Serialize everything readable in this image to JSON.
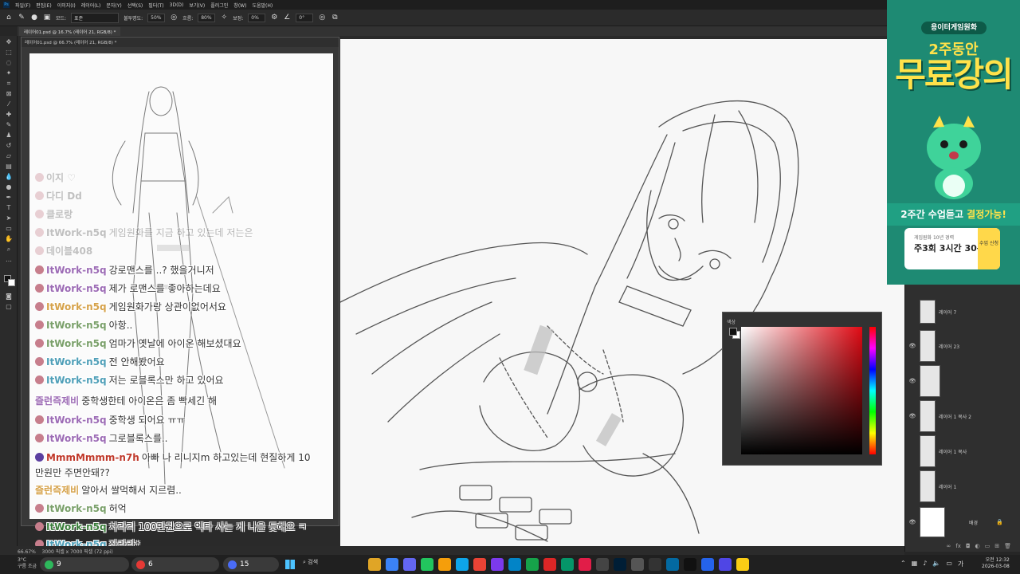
{
  "menubar": {
    "items": [
      "파일(F)",
      "편집(E)",
      "이미지(I)",
      "레이어(L)",
      "문자(Y)",
      "선택(S)",
      "필터(T)",
      "3D(D)",
      "보기(V)",
      "플러그인",
      "창(W)",
      "도움말(H)"
    ]
  },
  "options": {
    "mode_label": "모드:",
    "mode_value": "표준",
    "opacity_label": "불투명도:",
    "opacity_value": "50%",
    "flow_label": "흐름:",
    "flow_value": "80%",
    "smoothing_label": "보정:",
    "smoothing_value": "0%",
    "angle_value": "0°"
  },
  "document": {
    "tab_label": "레이어01.psd @ 16.7% (레이어 21, RGB/8) *",
    "float_title": "레이어01.psd @ 66.7% (레이어 21, RGB/8) *",
    "status_zoom": "66.67%",
    "status_size": "3000 픽셀 x 7000 픽셀 (72 ppi)"
  },
  "chat": {
    "messages": [
      {
        "name": "이지 ♡",
        "text": "",
        "faded": true,
        "color": "#aaaaaa"
      },
      {
        "name": "다디 Dd",
        "text": "",
        "faded": true,
        "color": "#aaaaaa"
      },
      {
        "name": "클로랑",
        "text": "",
        "faded": true,
        "color": "#aaaaaa"
      },
      {
        "name": "ItWork-n5q",
        "text": "게임원화를 지금 하고 있는데 저는은",
        "faded": true,
        "color": "#8a8a8a"
      },
      {
        "name": "데이블408",
        "text": "",
        "faded": true,
        "color": "#c77e8c"
      },
      {
        "name": "ItWork-n5q",
        "text": "강로맨스를 ..? 했을거니저",
        "faded": false,
        "color": "#9c6bb5"
      },
      {
        "name": "ItWork-n5q",
        "text": "제가 로맨스를 좋아하는데요",
        "faded": false,
        "color": "#9c6bb5"
      },
      {
        "name": "ItWork-n5q",
        "text": "게임원화가랑 상관이없어서요",
        "faded": false,
        "color": "#d6a24a"
      },
      {
        "name": "ItWork-n5q",
        "text": "아항..",
        "faded": false,
        "color": "#7aa06a"
      },
      {
        "name": "ItWork-n5q",
        "text": "엄마가 옛날에 아이온 해보셨대요",
        "faded": false,
        "color": "#7aa06a"
      },
      {
        "name": "ItWork-n5q",
        "text": "전 안해봤어요",
        "faded": false,
        "color": "#4f9fb8"
      },
      {
        "name": "ItWork-n5q",
        "text": "저는 로블록스만 하고 있어요",
        "faded": false,
        "color": "#4f9fb8"
      },
      {
        "name": "즐런즉제비",
        "text": "중학생한테 아이온은 좀 빡세긴 해",
        "faded": false,
        "color": "#9c6bb5"
      },
      {
        "name": "ItWork-n5q",
        "text": "중학생 되어요 ㅠㅠ",
        "faded": false,
        "color": "#9c6bb5"
      },
      {
        "name": "ItWork-n5q",
        "text": "그로블록스를..",
        "faded": false,
        "color": "#9c6bb5"
      },
      {
        "name": "MmmMmmm-n7h",
        "text": "아빠 나 리니지m 하고있는데 현질하게 10",
        "faded": false,
        "color": "#c0392b"
      },
      {
        "name": "",
        "text": "만원만 주면안돼??",
        "faded": false,
        "color": "#333333"
      },
      {
        "name": "즐런즉제비",
        "text": "알아서 쌀먹해서 지르렴..",
        "faded": false,
        "color": "#d6a24a"
      },
      {
        "name": "ItWork-n5q",
        "text": "허억",
        "faded": false,
        "color": "#7aa06a"
      },
      {
        "name": "ItWork-n5q",
        "text": "차라리 100만원으로 엑타 사는 게 나을 듯해요 ㅋ",
        "faded": false,
        "color": "#3a7d3a"
      },
      {
        "name": "ItWork-n5q",
        "text": "좌라라*",
        "faded": false,
        "color": "#4f9fb8"
      }
    ]
  },
  "ad": {
    "pill": "용이터게임원화",
    "sub": "2주동안",
    "title": "무료강의",
    "strip_a": "2주간 수업듣고 ",
    "strip_b": "결정가능!",
    "card_line1": "게임원화 10년 경력",
    "card_line2": "주3회 3시간 30분",
    "card_cta": "수업 신청"
  },
  "layers": [
    {
      "name": "레이어 7",
      "visible": false
    },
    {
      "name": "레이어 23",
      "visible": true
    },
    {
      "name": "",
      "visible": true
    },
    {
      "name": "레이어 1 복사 2",
      "visible": true
    },
    {
      "name": "레이어 1 복사",
      "visible": false
    },
    {
      "name": "레이어 1",
      "visible": false
    },
    {
      "name": "배경",
      "visible": true
    }
  ],
  "color_panel": {
    "title": "색상"
  },
  "taskbar": {
    "weather_temp": "3°C",
    "weather_desc": "구름 조금",
    "pill1_count": "9",
    "pill2_count": "6",
    "pill3_count": "15",
    "search_label": "검색",
    "time": "오전 12:32",
    "date": "2026-03-08"
  },
  "colors": {
    "ad_bg": "#1e8a73",
    "ad_yellow": "#ffe24a",
    "ps_bg": "#2b2b2b"
  }
}
